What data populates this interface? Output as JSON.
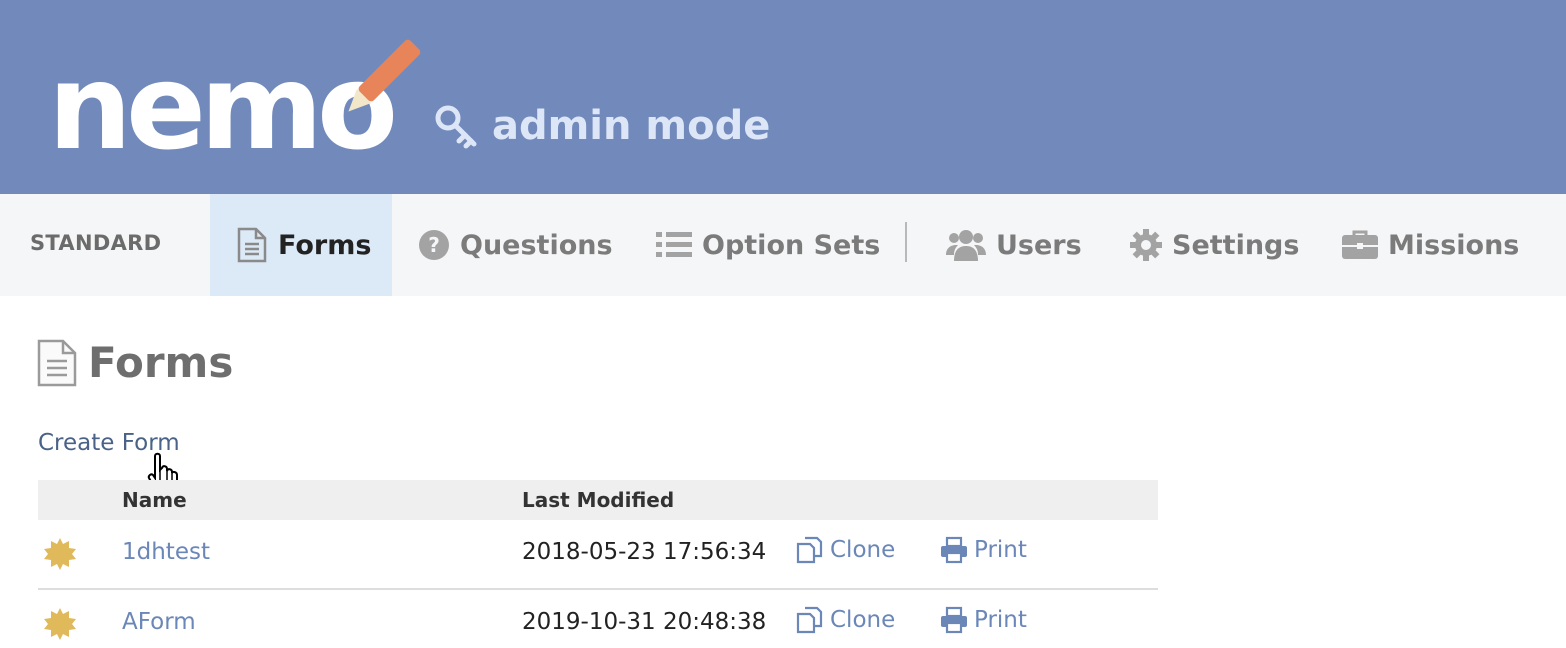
{
  "header": {
    "logo_text": "nemo",
    "mode_label": "admin mode",
    "mode_icon": "key-icon"
  },
  "nav": {
    "section_label": "STANDARD",
    "items": [
      {
        "label": "Forms",
        "icon": "file-text-icon",
        "active": true
      },
      {
        "label": "Questions",
        "icon": "question-circle-icon"
      },
      {
        "label": "Option Sets",
        "icon": "list-icon"
      },
      {
        "label": "Users",
        "icon": "users-icon"
      },
      {
        "label": "Settings",
        "icon": "gear-icon"
      },
      {
        "label": "Missions",
        "icon": "briefcase-icon"
      }
    ]
  },
  "main": {
    "title": "Forms",
    "title_icon": "file-text-icon",
    "create_link": "Create Form",
    "table": {
      "columns": [
        "Name",
        "Last Modified"
      ],
      "rows": [
        {
          "name": "1dhtest",
          "last_modified": "2018-05-23 17:56:34",
          "clone_label": "Clone",
          "print_label": "Print"
        },
        {
          "name": "AForm",
          "last_modified": "2019-10-31 20:48:38",
          "clone_label": "Clone",
          "print_label": "Print"
        }
      ]
    }
  },
  "colors": {
    "header_bg": "#7189bb",
    "nav_bg": "#f5f6f7",
    "nav_active_bg": "#dce9f6",
    "link": "#6b87b8",
    "pencil": "#e8845a",
    "badge": "#e0b95a"
  }
}
